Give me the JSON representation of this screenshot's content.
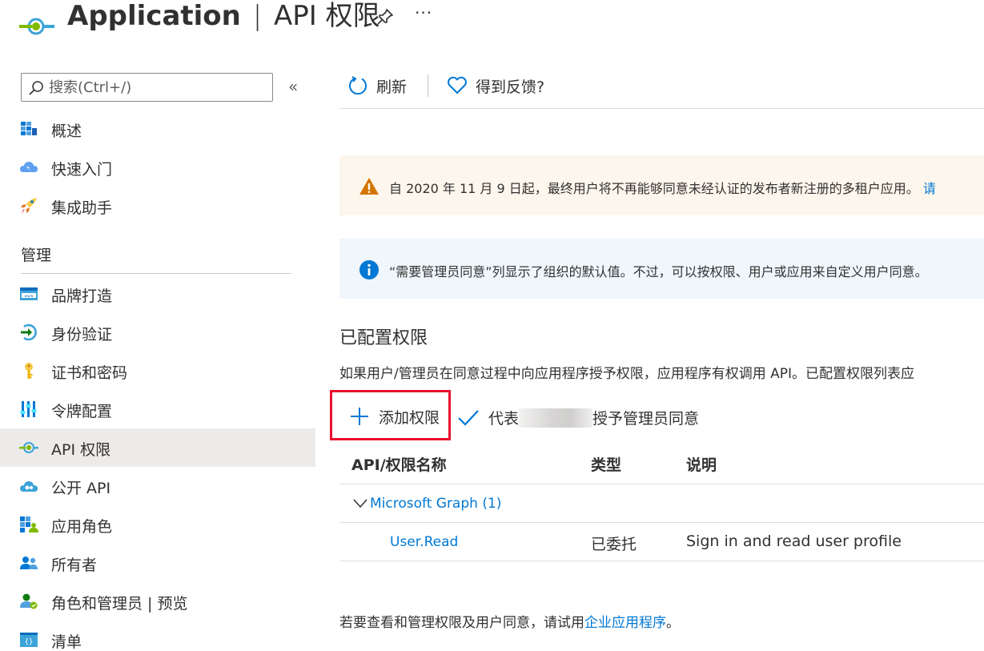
{
  "header": {
    "title_strong": "Application",
    "title_sep": "|",
    "title_rest": "API 权限",
    "logo_icon": "api-permissions-icon",
    "pin_icon": "pin-icon",
    "more": "···"
  },
  "sidebar": {
    "search_placeholder": "搜索(Ctrl+/)",
    "collapse": "«",
    "items_top": [
      {
        "label": "概述",
        "icon": "overview-icon"
      },
      {
        "label": "快速入门",
        "icon": "quickstart-icon"
      },
      {
        "label": "集成助手",
        "icon": "rocket-icon"
      }
    ],
    "section": "管理",
    "items_manage": [
      {
        "label": "品牌打造",
        "icon": "branding-icon"
      },
      {
        "label": "身份验证",
        "icon": "authentication-icon"
      },
      {
        "label": "证书和密码",
        "icon": "key-icon"
      },
      {
        "label": "令牌配置",
        "icon": "token-config-icon"
      },
      {
        "label": "API 权限",
        "icon": "api-permissions-icon",
        "active": true
      },
      {
        "label": "公开 API",
        "icon": "expose-api-icon"
      },
      {
        "label": "应用角色",
        "icon": "app-roles-icon"
      },
      {
        "label": "所有者",
        "icon": "owners-icon"
      },
      {
        "label": "角色和管理员 | 预览",
        "icon": "roles-admins-icon"
      },
      {
        "label": "清单",
        "icon": "manifest-icon"
      }
    ]
  },
  "toolbar": {
    "refresh": "刷新",
    "feedback": "得到反馈?"
  },
  "banners": {
    "warning": "自 2020 年 11 月 9 日起，最终用户将不再能够同意未经认证的发布者新注册的多租户应用。 ",
    "warning_tail": "请",
    "info": "“需要管理员同意”列显示了组织的默认值。不过，可以按权限、用户或应用来自定义用户同意。"
  },
  "configured": {
    "title": "已配置权限",
    "description": "如果用户/管理员在同意过程中向应用程序授予权限，应用程序有权调用 API。已配置权限列表应",
    "add_permission": "添加权限",
    "grant_prefix": "代表",
    "grant_suffix": "授予管理员同意"
  },
  "table": {
    "headers": [
      "API/权限名称",
      "类型",
      "说明"
    ],
    "group": "Microsoft Graph (1)",
    "rows": [
      {
        "name": "User.Read",
        "type": "已委托",
        "description": "Sign in and read user profile"
      }
    ]
  },
  "footer": {
    "text": "若要查看和管理权限及用户同意，请试用",
    "link": "企业应用程序",
    "end": "。"
  },
  "colors": {
    "accent": "#0078d4",
    "warning": "#d47500",
    "highlight_box": "#e8112d"
  }
}
